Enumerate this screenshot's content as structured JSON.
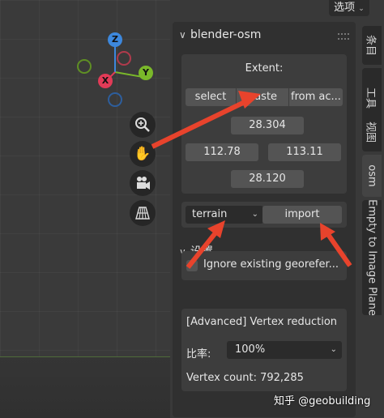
{
  "viewport": {
    "gizmo_axes": {
      "z": "Z",
      "x": "X",
      "y": "Y"
    },
    "colors": {
      "x": "#e23b57",
      "y": "#7ab82a",
      "z": "#3d88dd"
    },
    "tools": [
      "zoom-icon",
      "hand-pan-icon",
      "camera-icon",
      "grid-perspective-icon"
    ]
  },
  "header": {
    "options_label": "选项"
  },
  "panel": {
    "title": "blender-osm",
    "extent": {
      "title": "Extent:",
      "select_label": "select",
      "paste_label": "paste",
      "from_active_label": "from ac...",
      "top": "28.304",
      "left": "112.78",
      "right": "113.11",
      "bottom": "28.120"
    },
    "data_type": {
      "selected": "terrain"
    },
    "import_label": "import",
    "settings": {
      "title": "设置",
      "ignore_georef_label": "Ignore existing georefer...",
      "ignore_georef_checked": false,
      "vertex_reduction_title": "[Advanced] Vertex reduction",
      "ratio_label": "比率:",
      "ratio_value": "100%",
      "vertex_count_label": "Vertex count: 792,285"
    }
  },
  "tabs": [
    {
      "label": "条目",
      "active": false
    },
    {
      "label": "工具",
      "active": false
    },
    {
      "label": "视图",
      "active": false
    },
    {
      "label": "osm",
      "active": true
    },
    {
      "label": "Empty to Image Plane",
      "active": false
    }
  ],
  "watermark": "知乎 @geobuilding",
  "annotation_color": "#e8432c"
}
